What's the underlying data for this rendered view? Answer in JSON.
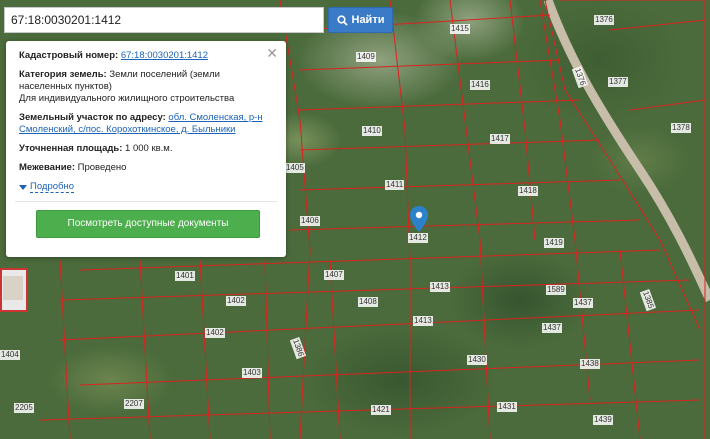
{
  "search": {
    "value": "67:18:0030201:1412",
    "button_label": "Найти"
  },
  "panel": {
    "cadastral_label": "Кадастровый номер:",
    "cadastral_value": "67:18:0030201:1412",
    "category_label": "Категория земель:",
    "category_value": "Земли поселений (земли населенных пунктов)",
    "usage_value": "Для индивидуального жилищного строительства",
    "address_label": "Земельный участок по адресу:",
    "address_value": "обл. Смоленская, р-н Смоленский, с/пос. Корохоткинское, д. Быльники",
    "area_label": "Уточненная площадь:",
    "area_value": "1 000 кв.м.",
    "survey_label": "Межевание:",
    "survey_value": "Проведено",
    "more_label": "Подробно",
    "docs_button": "Посмотреть доступные документы"
  },
  "map": {
    "plot_labels": [
      "1409",
      "1415",
      "1376",
      "1416",
      "1377",
      "1410",
      "1417",
      "1378",
      "1376",
      "1411",
      "1418",
      "1406",
      "1412",
      "1419",
      "1407",
      "1401",
      "1413",
      "1589",
      "1437",
      "1402",
      "1408",
      "1402",
      "1413",
      "1437",
      "1403",
      "1430",
      "1438",
      "1431",
      "1421",
      "1439",
      "2205",
      "2207",
      "1386",
      "1385",
      "1405",
      "1404"
    ],
    "marker_color": "#2b82cb",
    "boundary_color": "#d9231f"
  }
}
